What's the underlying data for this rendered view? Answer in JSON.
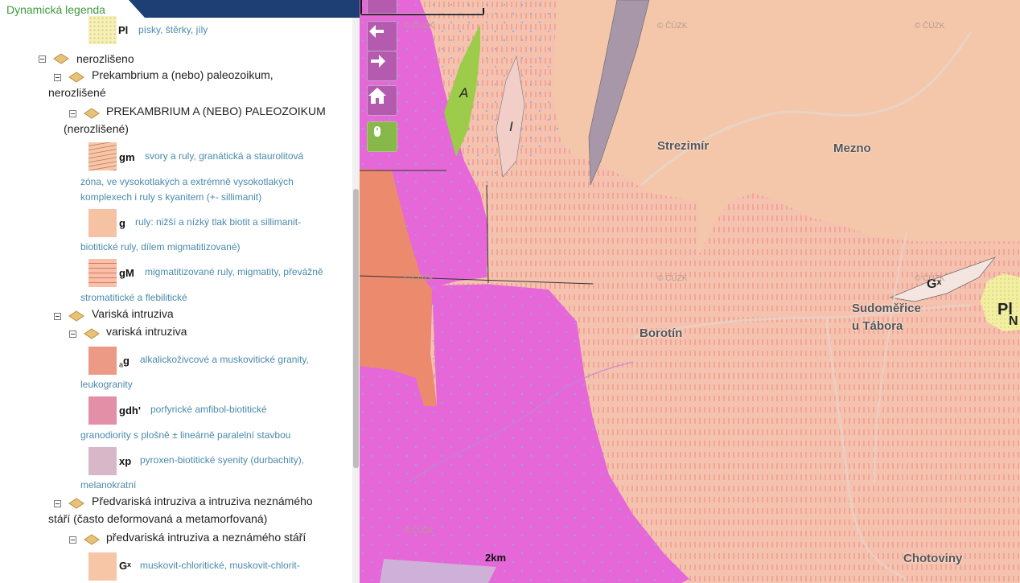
{
  "panel": {
    "title": "Dynamická legenda"
  },
  "legend": {
    "top_item": {
      "code": "Pl",
      "desc": "písky, štěrky, jíly",
      "color": "#f5f0b8"
    },
    "nerozliseno": "nerozlišeno",
    "prekambrium_group_line1": "Prekambrium a (nebo) paleozoikum,",
    "prekambrium_group_line2": "nerozlišené",
    "prekambrium_sub_line1": "PREKAMBRIUM A (NEBO) PALEOZOIKUM",
    "prekambrium_sub_line2": "(nerozlišené)",
    "items_prek": [
      {
        "code": "gm",
        "desc1": "svory a ruly, granátická a staurolitová",
        "desc2": "zóna, ve vysokotlakých a extrémně vysokotlakých",
        "desc3": "komplexech i ruly s kyanitem (+- sillimanit)",
        "color": "#f7c6a8"
      },
      {
        "code": "g",
        "desc1": "ruly: nižší a nízký tlak biotit a sillimanit-",
        "desc2": "biotitické ruly, dílem migmatitizované)",
        "color": "#f5c3a4"
      },
      {
        "code": "gM",
        "desc1": "migmatitizované ruly, migmatity, převážně",
        "desc2": "stromatitické a flebilitické",
        "color": "#f7c0ab"
      }
    ],
    "variska_group": "Variská intruziva",
    "variska_sub": "variská intruziva",
    "items_var": [
      {
        "code_sub": "a",
        "code": "g",
        "desc1": "alkalickoživcové a muskovitické granity,",
        "desc2": "leukogranity",
        "color": "#ec9a86"
      },
      {
        "code": "gdh'",
        "desc1": "porfyrické amfibol-biotitické",
        "desc2": "granodiority s plošně ± lineárně paralelní stavbou",
        "color": "#e38fa8"
      },
      {
        "code": "xp",
        "desc1": "pyroxen-biotitické syenity (durbachity),",
        "desc2": "melanokratní",
        "color": "#d8b8c8"
      }
    ],
    "predvariska_group_line1": "Předvariská intruziva a intruziva neznámého",
    "predvariska_group_line2": "stáří (často deformovaná a metamorfovaná)",
    "predvariska_sub": "předvariská intruziva a neznámého stáří",
    "last_item": {
      "code": "Gˣ",
      "desc1": "muskovit-chloritické, muskovit-chlorit-",
      "color": "#f7c6a6"
    }
  },
  "map": {
    "towns": [
      "Strezimír",
      "Mezno",
      "Borotín",
      "Sudoměřice",
      "u Tábora",
      "Chotoviny"
    ],
    "watermark": "© ČÚZK",
    "unit_labels": [
      "A",
      "I",
      "Gˣ",
      "Pl",
      "N"
    ],
    "scale_label": "2km"
  },
  "colors": {
    "pink_magenta": "#e667d8",
    "salmon": "#f6c2b0",
    "peach": "#f3c6aa",
    "orange_red": "#ec8a6e",
    "green": "#9ccc4a",
    "yellow": "#f2f0a0",
    "accent_green": "#3d9b3d",
    "header_blue": "#1d3f73"
  }
}
